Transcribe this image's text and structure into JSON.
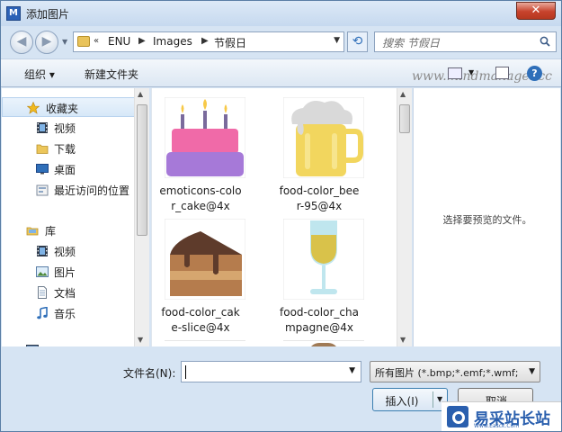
{
  "window": {
    "title": "添加图片",
    "close_label": "✕"
  },
  "address": {
    "overflow": "«",
    "parts": [
      "ENU",
      "Images",
      "节假日"
    ]
  },
  "search": {
    "placeholder": "搜索 节假日"
  },
  "toolbar": {
    "organize_label": "组织 ▾",
    "new_folder_label": "新建文件夹",
    "watermark": "www.mindmanager.cc"
  },
  "nav": {
    "items": [
      {
        "label": "收藏夹",
        "icon": "star-icon"
      },
      {
        "label": "视频",
        "icon": "video-icon"
      },
      {
        "label": "下载",
        "icon": "folder-icon"
      },
      {
        "label": "桌面",
        "icon": "desktop-icon"
      },
      {
        "label": "最近访问的位置",
        "icon": "recent-places-icon"
      },
      {
        "label": "库",
        "icon": "library-icon"
      },
      {
        "label": "视频",
        "icon": "video-icon"
      },
      {
        "label": "图片",
        "icon": "pictures-icon"
      },
      {
        "label": "文档",
        "icon": "documents-icon"
      },
      {
        "label": "音乐",
        "icon": "music-icon"
      }
    ]
  },
  "files": [
    {
      "name": "emoticons-color_cake@4x",
      "line1": "emoticons-colo",
      "line2": "r_cake@4x"
    },
    {
      "name": "food-color_beer-95@4x",
      "line1": "food-color_bee",
      "line2": "r-95@4x"
    },
    {
      "name": "food-color_cake-slice@4x",
      "line1": "food-color_cak",
      "line2": "e-slice@4x"
    },
    {
      "name": "food-color_champagne@4x",
      "line1": "food-color_cha",
      "line2": "mpagne@4x"
    }
  ],
  "preview": {
    "text": "选择要预览的文件。"
  },
  "bottom": {
    "filename_label": "文件名(N):",
    "filename_value": "",
    "filter_label": "所有图片 (*.bmp;*.emf;*.wmf;",
    "insert_label": "插入(I)",
    "cancel_label": "取消"
  },
  "logo": {
    "text": "易采站长站",
    "sub": "Www.Easck.Com"
  },
  "colors": {
    "cake_pink": "#f06aa8",
    "cake_purple": "#a679d8",
    "candle_flame": "#f7c948",
    "beer_yellow": "#f2d65e",
    "chocolate": "#5e3b2b",
    "champagne": "#d9c24a",
    "glass": "#bfe6ee"
  }
}
